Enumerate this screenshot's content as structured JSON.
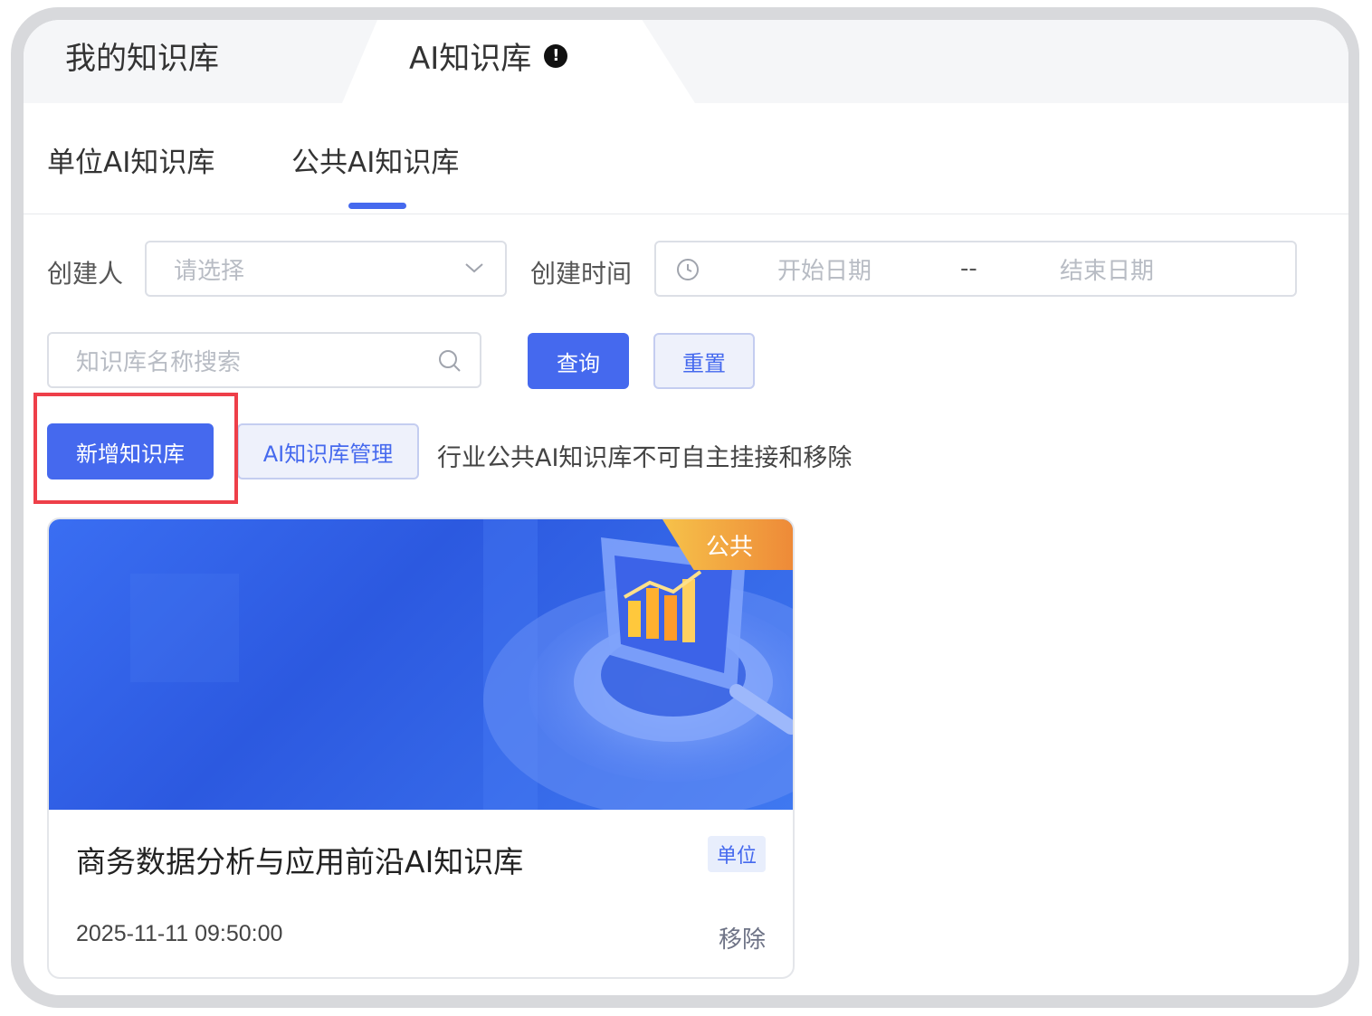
{
  "tabs": {
    "main": [
      {
        "label": "我的知识库"
      },
      {
        "label": "AI知识库"
      }
    ],
    "sub": [
      {
        "label": "单位AI知识库"
      },
      {
        "label": "公共AI知识库"
      }
    ]
  },
  "filters": {
    "creator_label": "创建人",
    "creator_placeholder": "请选择",
    "time_label": "创建时间",
    "start_placeholder": "开始日期",
    "separator": "--",
    "end_placeholder": "结束日期",
    "search_placeholder": "知识库名称搜索",
    "query_button": "查询",
    "reset_button": "重置"
  },
  "actions": {
    "add_button": "新增知识库",
    "manage_button": "AI知识库管理",
    "hint": "行业公共AI知识库不可自主挂接和移除"
  },
  "cards": [
    {
      "badge": "公共",
      "title": "商务数据分析与应用前沿AI知识库",
      "tag": "单位",
      "date": "2025-11-11 09:50:00",
      "remove": "移除"
    }
  ],
  "colors": {
    "primary": "#4569ee",
    "highlight": "#ee3f49",
    "badge": "#f6c24a"
  }
}
